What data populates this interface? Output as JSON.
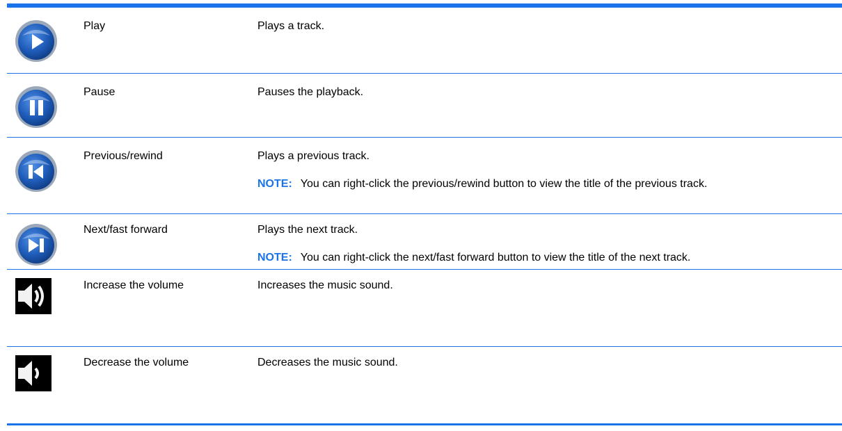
{
  "colors": {
    "accent": "#1a73e8",
    "button_blue": "#1e5bb8",
    "button_rim": "#8a9bb0",
    "speaker_bg": "#000000"
  },
  "rows": [
    {
      "icon": "play-icon",
      "name": "Play",
      "description": "Plays a track.",
      "note_label": "",
      "note_text": ""
    },
    {
      "icon": "pause-icon",
      "name": "Pause",
      "description": "Pauses the playback.",
      "note_label": "",
      "note_text": ""
    },
    {
      "icon": "previous-icon",
      "name": "Previous/rewind",
      "description": "Plays a previous track.",
      "note_label": "NOTE:",
      "note_text": "You can right-click the previous/rewind button to view the title of the previous track."
    },
    {
      "icon": "next-icon",
      "name": "Next/fast forward",
      "description": "Plays the next track.",
      "note_label": "NOTE:",
      "note_text": "You can right-click the next/fast forward button to view the title of the next track."
    },
    {
      "icon": "volume-up-icon",
      "name": "Increase the volume",
      "description": "Increases the music sound.",
      "note_label": "",
      "note_text": ""
    },
    {
      "icon": "volume-down-icon",
      "name": "Decrease the volume",
      "description": "Decreases the music sound.",
      "note_label": "",
      "note_text": ""
    }
  ]
}
